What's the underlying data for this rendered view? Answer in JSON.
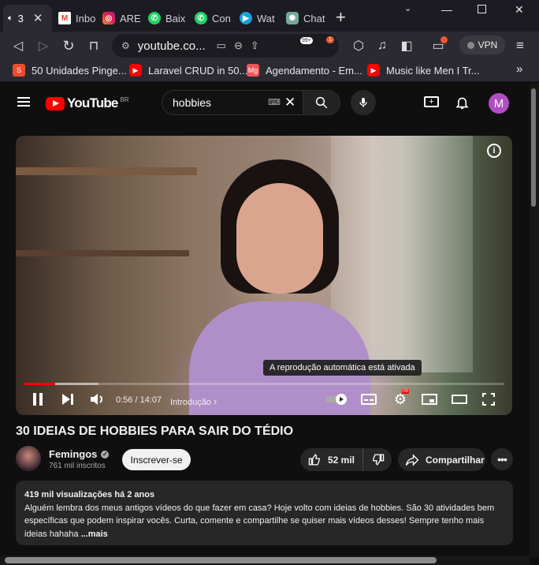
{
  "browser": {
    "tabs": [
      {
        "label": "3",
        "icon": "speaker-icon",
        "active": true
      },
      {
        "label": "Inbo",
        "icon": "gmail-icon"
      },
      {
        "label": "ARE",
        "icon": "instagram-icon"
      },
      {
        "label": "Baix",
        "icon": "whatsapp-icon"
      },
      {
        "label": "Con",
        "icon": "whatsapp-icon"
      },
      {
        "label": "Wat",
        "icon": "play-app-icon"
      },
      {
        "label": "Chat",
        "icon": "chatgpt-icon"
      }
    ],
    "new_tab_label": "+",
    "url": "youtube.co...",
    "brave_count": "99+",
    "rewards_count": "1",
    "vpn_label": "VPN",
    "bookmarks": [
      {
        "label": "50 Unidades Pinge...",
        "icon": "shopee-icon",
        "color": "#ee4d2d"
      },
      {
        "label": "Laravel CRUD in 50...",
        "icon": "youtube-icon",
        "color": "#ff0000"
      },
      {
        "label": "Agendamento - Em...",
        "icon": "mg-icon",
        "color": "#e55"
      },
      {
        "label": "Music like Men I Tr...",
        "icon": "youtube-icon",
        "color": "#ff0000"
      }
    ],
    "bookmarks_overflow": "»"
  },
  "youtube": {
    "logo_text": "YouTube",
    "region": "BR",
    "search_value": "hobbies",
    "avatar_letter": "M"
  },
  "player": {
    "autoplay_toast": "A reprodução automática está ativada",
    "current_time": "0:56 / 14:07",
    "chapter": "Introdução",
    "progress_fraction": 0.066,
    "buffer_fraction": 0.155,
    "hd_badge": "HD"
  },
  "video": {
    "title": "30 IDEIAS DE HOBBIES PARA SAIR DO TÉDIO",
    "channel_name": "Femingos",
    "subscribers": "761 mil inscritos",
    "subscribe_label": "Inscrever-se",
    "likes": "52 mil",
    "share_label": "Compartilhar",
    "more_label": "•••",
    "description": {
      "meta": "419 mil visualizações  há 2 anos",
      "text": "Alguém lembra dos meus antigos vídeos do que fazer em casa? Hoje volto com ideias de hobbies. São 30 atividades bem específicas que podem inspirar vocês. Curta, comente e compartilhe se quiser mais vídeos desses! Sempre tenho mais ideias hahaha ",
      "more_link": "...mais"
    }
  },
  "colors": {
    "accent": "#ff0000",
    "background": "#0f0f0f",
    "avatar": "#b14ec4"
  }
}
